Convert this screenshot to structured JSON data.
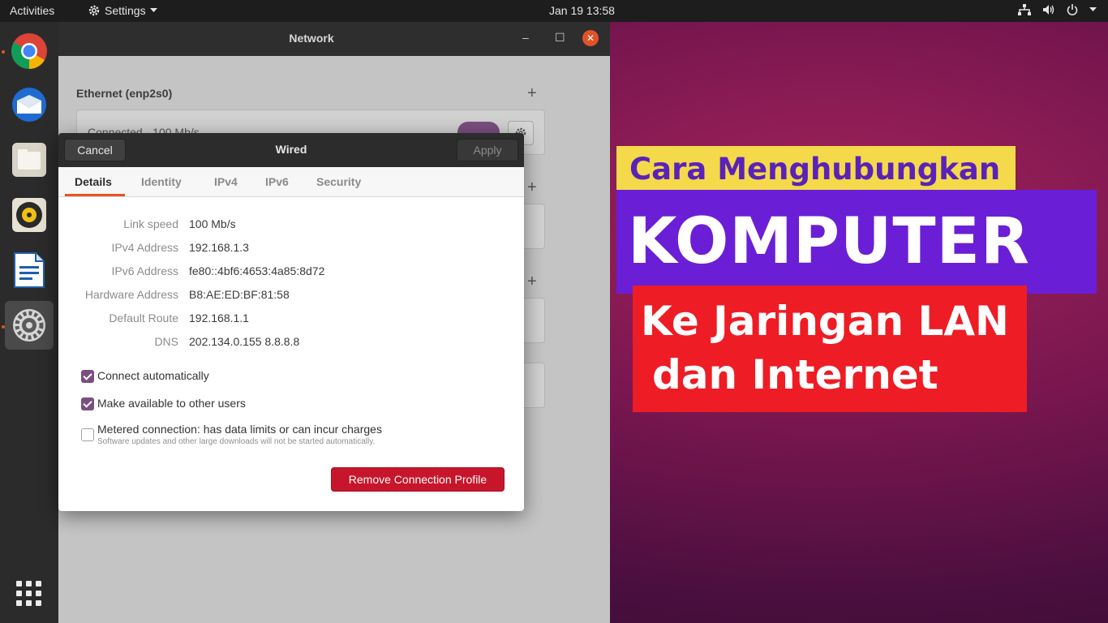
{
  "topbar": {
    "activities": "Activities",
    "app_menu": "Settings",
    "clock": "Jan 19  13:58"
  },
  "dock": {
    "items": [
      "chrome-icon",
      "thunderbird-icon",
      "files-icon",
      "rhythmbox-icon",
      "writer-icon",
      "settings-icon",
      "app-grid-icon"
    ]
  },
  "network_window": {
    "title": "Network",
    "section_title": "Ethernet (enp2s0)",
    "status": "Connected - 100 Mb/s",
    "toggle_on": true
  },
  "wired_dialog": {
    "title": "Wired",
    "cancel_label": "Cancel",
    "apply_label": "Apply",
    "tabs": [
      {
        "label": "Details",
        "selected": true
      },
      {
        "label": "Identity",
        "selected": false
      },
      {
        "label": "IPv4",
        "selected": false
      },
      {
        "label": "IPv6",
        "selected": false
      },
      {
        "label": "Security",
        "selected": false
      }
    ],
    "details": [
      {
        "label": "Link speed",
        "value": "100 Mb/s"
      },
      {
        "label": "IPv4 Address",
        "value": "192.168.1.3"
      },
      {
        "label": "IPv6 Address",
        "value": "fe80::4bf6:4653:4a85:8d72"
      },
      {
        "label": "Hardware Address",
        "value": "B8:AE:ED:BF:81:58"
      },
      {
        "label": "Default Route",
        "value": "192.168.1.1"
      },
      {
        "label": "DNS",
        "value": "202.134.0.155 8.8.8.8"
      }
    ],
    "options": [
      {
        "label": "Connect automatically",
        "checked": true
      },
      {
        "label": "Make available to other users",
        "checked": true
      },
      {
        "label": "Metered connection: has data limits or can incur charges",
        "checked": false
      }
    ],
    "metered_sub": "Software updates and other large downloads will not be started automatically.",
    "remove_label": "Remove Connection Profile"
  },
  "overlay": {
    "line1": "Cara Menghubungkan",
    "line2": "KOMPUTER",
    "line3": "Ke Jaringan LAN",
    "line4": "dan Internet"
  },
  "colors": {
    "accent": "#e95420",
    "check": "#7a4e7f",
    "danger": "#c7162b",
    "banner_yellow": "#f4d94a",
    "banner_purple": "#6a1fd6",
    "banner_red": "#ee1c24"
  }
}
